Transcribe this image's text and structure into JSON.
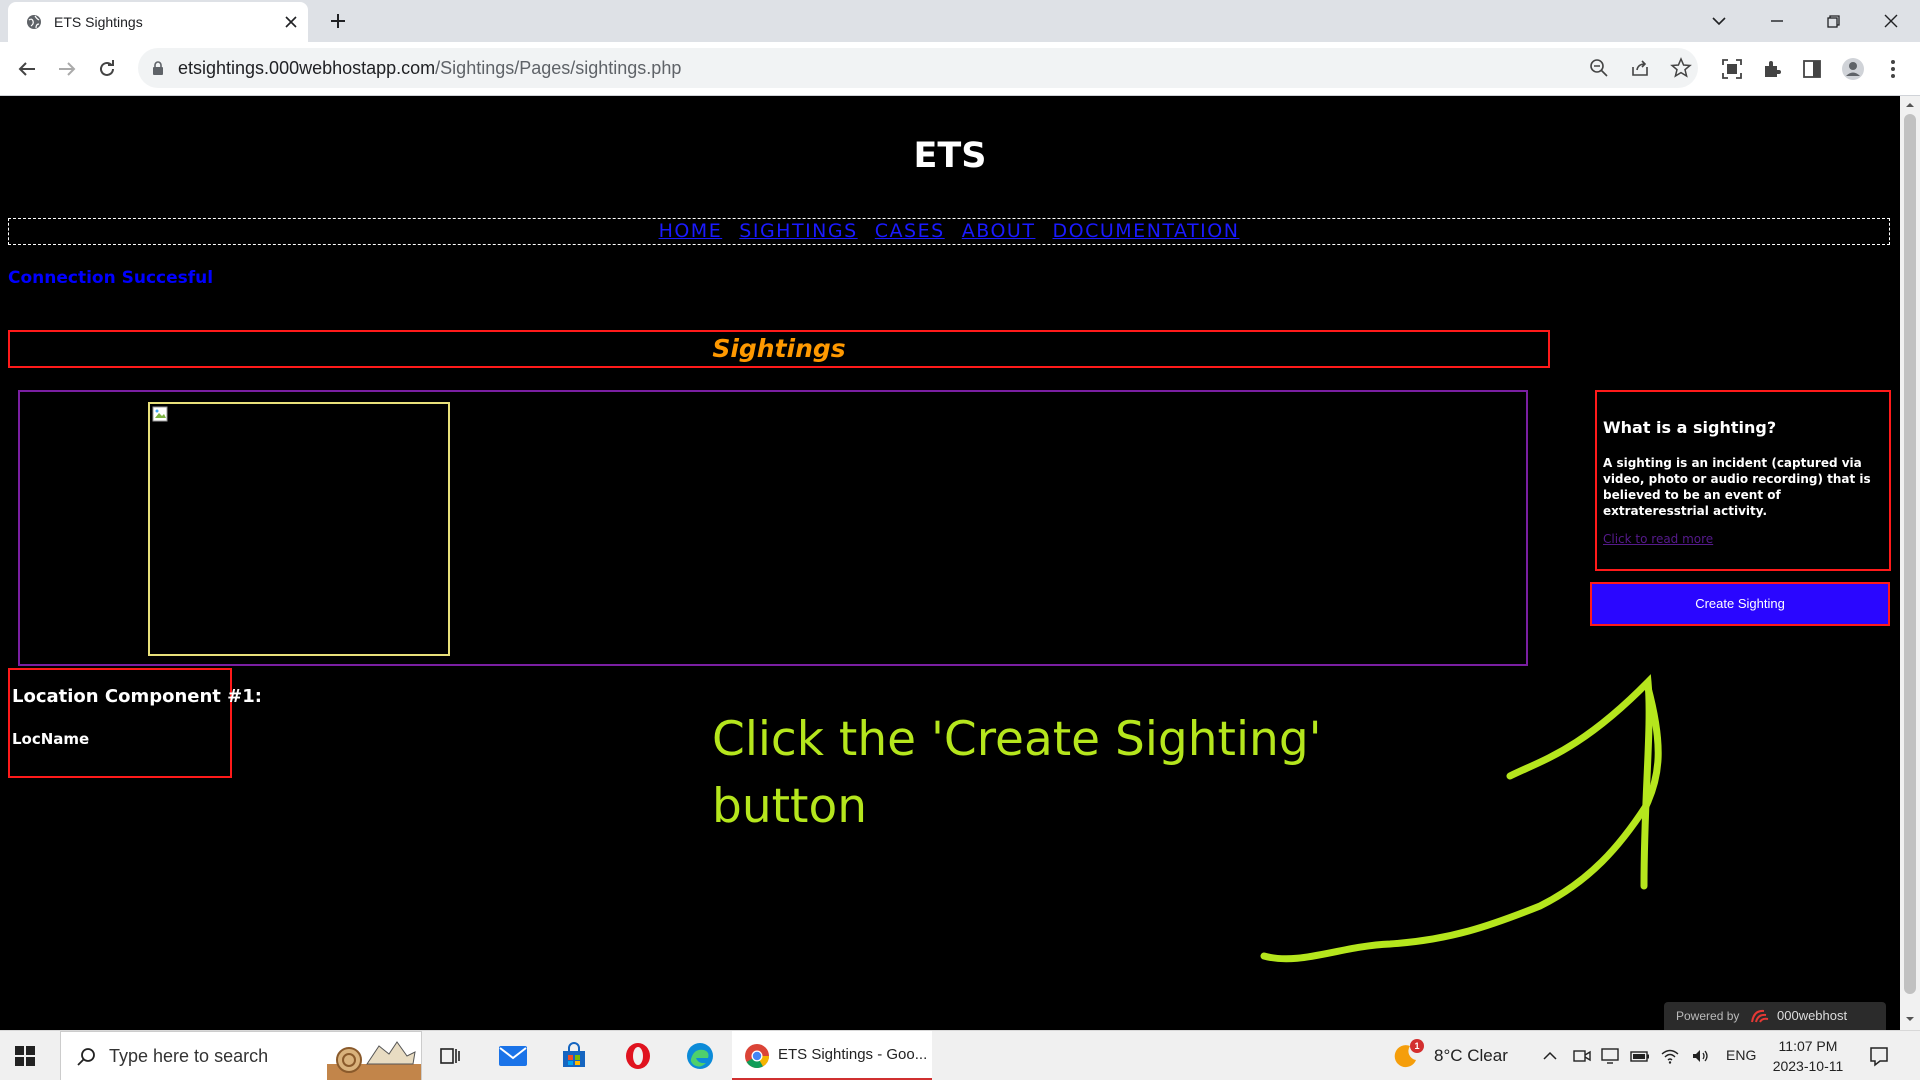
{
  "browser": {
    "tab_title": "ETS Sightings",
    "url_host": "etsightings.000webhostapp.com",
    "url_path": "/Sightings/Pages/sightings.php"
  },
  "site": {
    "title": "ETS",
    "nav": [
      "HOME",
      "SIGHTINGS",
      "CASES",
      "ABOUT",
      "DOCUMENTATION"
    ],
    "connection_status": "Connection Succesful"
  },
  "main": {
    "section_title": "Sightings",
    "location": {
      "heading": "Location Component #1:",
      "name": "LocName"
    }
  },
  "sidebar": {
    "info_title": "What is a sighting?",
    "info_text": "A sighting is an incident (captured via video, photo or audio recording) that is believed to be an event of extrateresstrial activity.",
    "info_link": "Click to read more",
    "create_button": "Create Sighting"
  },
  "annotation": {
    "line1": "Click the 'Create Sighting'",
    "line2": "button"
  },
  "hosting_badge": {
    "label": "Powered by",
    "brand": "000webhost"
  },
  "taskbar": {
    "search_placeholder": "Type here to search",
    "chrome_task_label": "ETS Sightings - Goo...",
    "weather_badge": "1",
    "weather": "8°C  Clear",
    "language": "ENG",
    "time": "11:07 PM",
    "date": "2023-10-11"
  },
  "colors": {
    "annotation": "#b5e61d",
    "nav_link": "#1a1aff",
    "section_title": "#ff9900",
    "border_red": "#ff1a1a",
    "create_button_bg": "#2a06ff"
  }
}
